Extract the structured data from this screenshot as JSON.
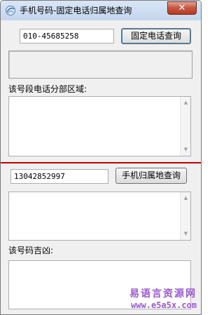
{
  "window": {
    "title": "手机号码-固定电话归属地查询",
    "close_glyph": "✕"
  },
  "landline": {
    "input_value": "010-45685258",
    "query_button_label": "固定电话查询",
    "result_text": "",
    "district_label": "该号段电话分部区域:",
    "district_text": ""
  },
  "mobile": {
    "input_value": "13042852997",
    "query_button_label": "手机归属地查询",
    "result_text": "",
    "luck_label": "该号码吉凶:",
    "luck_text": ""
  },
  "scrollbar": {
    "up_glyph": "▲",
    "down_glyph": "▼"
  },
  "watermark": {
    "brand": "易语言资源网",
    "url": "www.e5a5x.com"
  },
  "colors": {
    "divider": "#c00000",
    "watermark": "#9b59d0"
  }
}
